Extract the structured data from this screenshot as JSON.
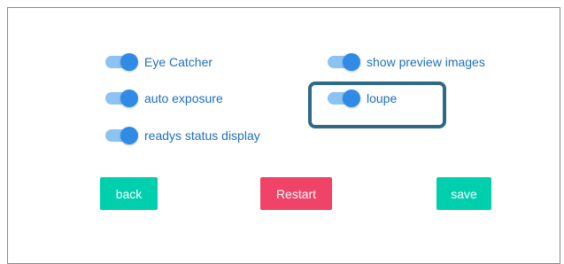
{
  "settings": {
    "eye_catcher": {
      "label": "Eye Catcher",
      "enabled": true
    },
    "auto_exposure": {
      "label": "auto exposure",
      "enabled": true
    },
    "readys_status_display": {
      "label": "readys status display",
      "enabled": true
    },
    "show_preview_images": {
      "label": "show preview images",
      "enabled": true
    },
    "loupe": {
      "label": "loupe",
      "enabled": true
    }
  },
  "buttons": {
    "back": {
      "label": "back",
      "color": "#00cfae"
    },
    "restart": {
      "label": "Restart",
      "color": "#f04368"
    },
    "save": {
      "label": "save",
      "color": "#00cfae"
    }
  },
  "colors": {
    "toggle_track": "#8cc3f3",
    "toggle_knob": "#2f8be6",
    "label_text": "#1f6fbd",
    "highlight_border": "#2e6a86"
  }
}
